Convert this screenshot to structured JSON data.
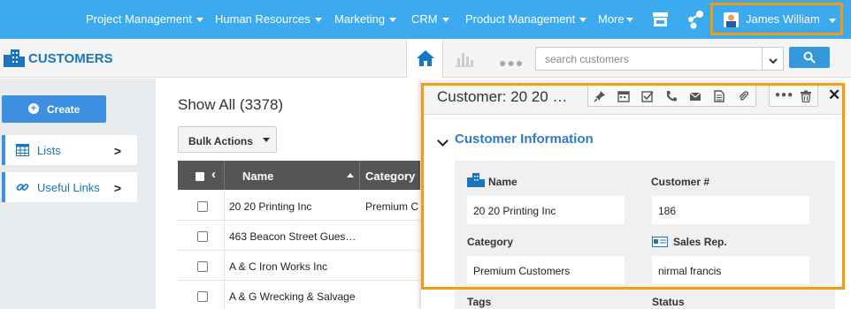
{
  "nav": {
    "items": [
      {
        "label": "Project Management"
      },
      {
        "label": "Human Resources"
      },
      {
        "label": "Marketing"
      },
      {
        "label": "CRM"
      },
      {
        "label": "Product Management"
      },
      {
        "label": "More"
      }
    ],
    "user_name": "James William"
  },
  "subheader": {
    "title": "CUSTOMERS",
    "search_placeholder": "search customers"
  },
  "sidebar": {
    "create_label": "Create",
    "items": [
      {
        "label": "Lists"
      },
      {
        "label": "Useful Links"
      }
    ]
  },
  "list": {
    "show_all": "Show All (3378)",
    "bulk_actions": "Bulk Actions",
    "columns": {
      "name": "Name",
      "category": "Category"
    },
    "rows": [
      {
        "name": "20 20 Printing Inc",
        "category": "Premium C"
      },
      {
        "name": "463 Beacon Street Gues…",
        "category": ""
      },
      {
        "name": "A & C Iron Works Inc",
        "category": ""
      },
      {
        "name": "A & G Wrecking & Salvage",
        "category": ""
      }
    ]
  },
  "panel": {
    "title": "Customer: 20 20 …",
    "section": "Customer Information",
    "fields": {
      "name_label": "Name",
      "name_value": "20 20 Printing Inc",
      "number_label": "Customer #",
      "number_value": "186",
      "category_label": "Category",
      "category_value": "Premium Customers",
      "sales_label": "Sales Rep.",
      "sales_value": "nirmal francis",
      "tags_label": "Tags",
      "status_label": "Status"
    }
  },
  "colors": {
    "nav_bg": "#3baaee",
    "accent": "#1a75bc",
    "highlight": "#f39c12"
  }
}
